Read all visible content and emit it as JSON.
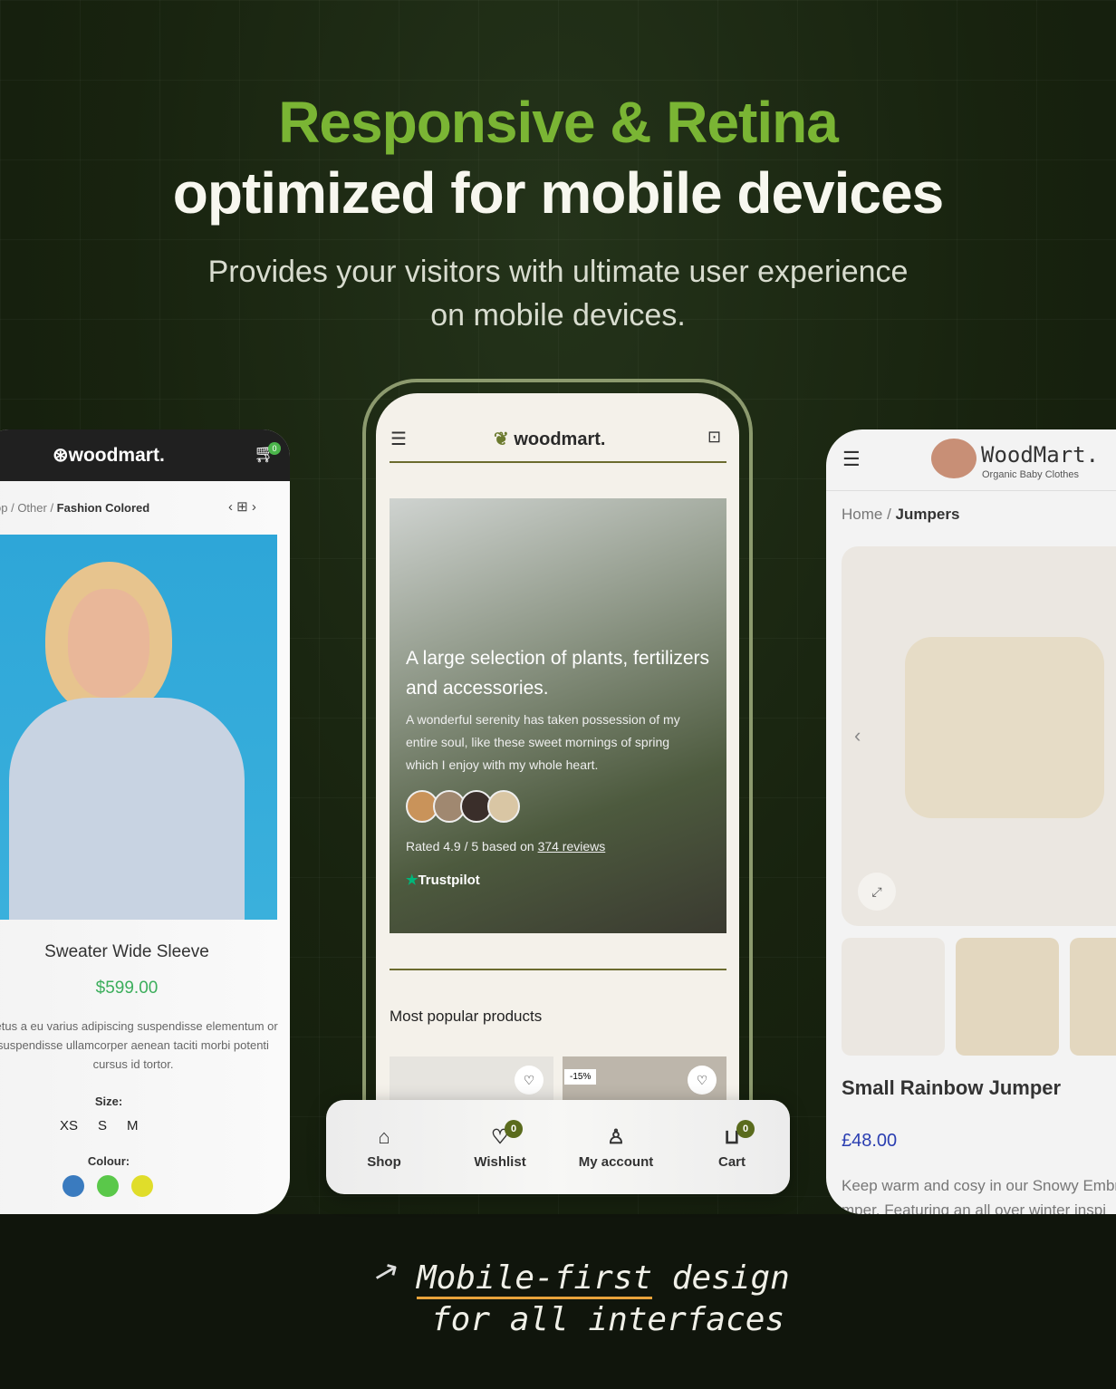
{
  "hero": {
    "title_green": "Responsive & Retina",
    "title_white": "optimized for mobile devices",
    "subtitle_line1": "Provides your visitors with ultimate user experience",
    "subtitle_line2": "on mobile devices.",
    "accent": "#7ab534"
  },
  "left_phone": {
    "logo": "woodmart.",
    "cart_count": "0",
    "breadcrumb": [
      "op",
      "Other",
      "Fashion Colored"
    ],
    "product_title": "Sweater Wide Sleeve",
    "price": "$599.00",
    "description": "netus a eu varius adipiscing suspendisse elementum or suspendisse ullamcorper aenean taciti morbi potenti cursus id tortor.",
    "size_label": "Size:",
    "sizes": [
      "XS",
      "S",
      "M"
    ],
    "colour_label": "Colour:",
    "colours": [
      "#3a7bbf",
      "#5ac84a",
      "#e0dd2a"
    ]
  },
  "center_phone": {
    "logo": "woodmart.",
    "hero_heading": "A large selection of plants, fertilizers and accessories.",
    "hero_text": "A wonderful serenity has taken possession of my entire soul, like these sweet mornings of spring which I enjoy with my whole heart.",
    "rating_prefix": "Rated 4.9 / 5 based on ",
    "rating_link": "374 reviews",
    "trustpilot": "Trustpilot",
    "section_title": "Most popular products",
    "discount_badge": "-15%"
  },
  "bottom_nav": {
    "items": [
      {
        "label": "Shop",
        "icon": "store-icon"
      },
      {
        "label": "Wishlist",
        "icon": "heart-icon",
        "count": "0"
      },
      {
        "label": "My account",
        "icon": "user-icon"
      },
      {
        "label": "Cart",
        "icon": "bag-icon",
        "count": "0"
      }
    ]
  },
  "right_phone": {
    "logo": "WoodMart.",
    "tagline": "Organic Baby Clothes",
    "breadcrumb": [
      "Home",
      "Jumpers"
    ],
    "product_title": "Small Rainbow Jumper",
    "price": "£48.00",
    "description": "Keep warm and cosy in our Snowy Embr",
    "description_2": "mper. Featuring an all over winter inspi"
  },
  "tagline": {
    "line1a": "Mobile-first",
    "line1b": "design",
    "line2": "for all interfaces"
  }
}
